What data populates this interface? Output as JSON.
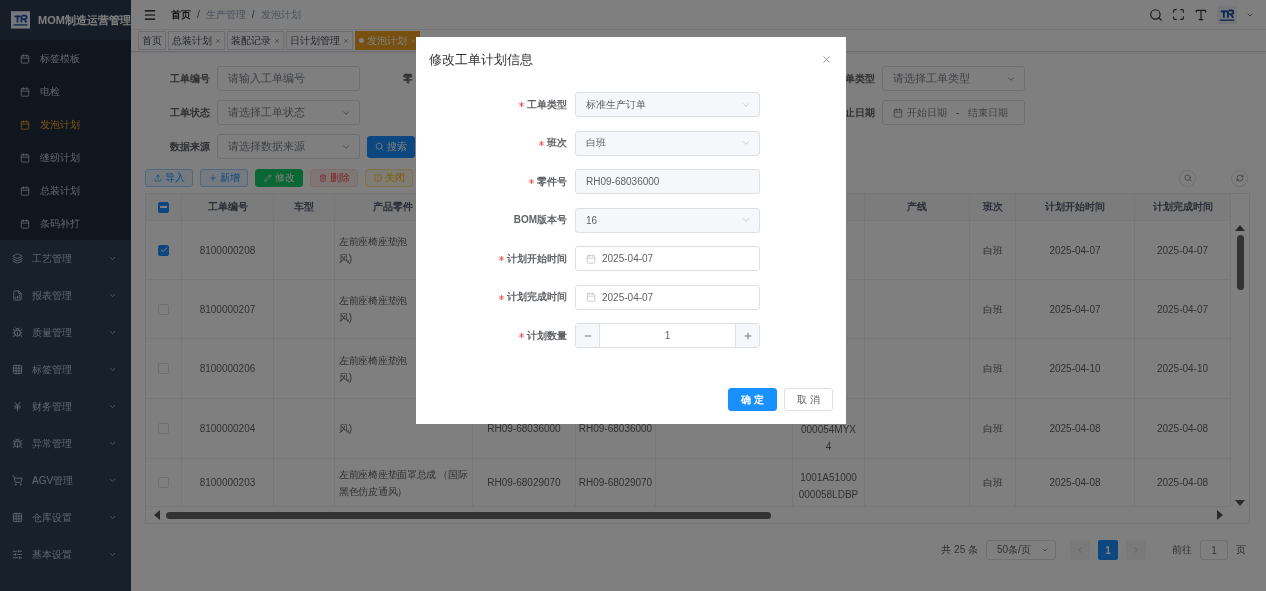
{
  "sidebar": {
    "title": "MOM制造运营管理",
    "submenu": [
      {
        "label": "标签模板",
        "selected": false
      },
      {
        "label": "电检",
        "selected": false
      },
      {
        "label": "发泡计划",
        "selected": true
      },
      {
        "label": "缝纫计划",
        "selected": false
      },
      {
        "label": "总装计划",
        "selected": false
      },
      {
        "label": "条码补打",
        "selected": false
      }
    ],
    "menus": [
      {
        "label": "工艺管理",
        "expanded": false
      },
      {
        "label": "报表管理",
        "expanded": false
      },
      {
        "label": "质量管理",
        "expanded": false
      },
      {
        "label": "标签管理",
        "expanded": false
      },
      {
        "label": "财务管理",
        "expanded": false
      },
      {
        "label": "异常管理",
        "expanded": false
      },
      {
        "label": "AGV管理",
        "expanded": false
      },
      {
        "label": "仓库设置",
        "expanded": false
      },
      {
        "label": "基本设置",
        "expanded": false
      }
    ]
  },
  "breadcrumb": [
    {
      "label": "首页"
    },
    {
      "separator": "/",
      "label": "生产管理"
    },
    {
      "separator": "/",
      "label": "发泡计划"
    }
  ],
  "tabs": [
    {
      "label": "首页",
      "closable": false,
      "selected": false
    },
    {
      "label": "总装计划",
      "closable": true,
      "selected": false
    },
    {
      "label": "装配记录",
      "closable": true,
      "selected": false
    },
    {
      "label": "日计划管理",
      "closable": true,
      "selected": false
    },
    {
      "label": "发泡计划",
      "closable": true,
      "selected": true
    }
  ],
  "filters": {
    "order_no": {
      "label": "工单编号",
      "placeholder": "请输入工单编号"
    },
    "part_label_fragment": "零",
    "order_status": {
      "label": "工单状态",
      "placeholder": "请选择工单状态"
    },
    "data_source": {
      "label": "数据来源",
      "placeholder": "请选择数据来源"
    },
    "search_button": "搜索",
    "order_type": {
      "label": "单类型",
      "placeholder": "请选择工单类型"
    },
    "date_range": {
      "label": "止日期",
      "start_placeholder": "开始日期",
      "separator": "-",
      "end_placeholder": "结束日期"
    }
  },
  "actions": [
    {
      "kind": "import",
      "label": "导入"
    },
    {
      "kind": "add",
      "label": "新增"
    },
    {
      "kind": "edit",
      "label": "修改"
    },
    {
      "kind": "delete",
      "label": "删除"
    },
    {
      "kind": "close",
      "label": "关闭"
    }
  ],
  "table": {
    "header_checkbox": {
      "indeterminate": true
    },
    "columns": {
      "order_no": "工单编号",
      "vehicle": "车型",
      "product_name": "产品零件",
      "production_line": "产线",
      "shift": "班次",
      "plan_start": "计划开始时间",
      "plan_end": "计划完成时间"
    },
    "rows": [
      {
        "selected": true,
        "order_no": "8100000208",
        "product_name": [
          "左前座椅座垫泡",
          "风)"
        ],
        "shift": "白班",
        "plan_start": "2025-04-07",
        "plan_end": "2025-04-07"
      },
      {
        "selected": false,
        "order_no": "8100000207",
        "product_name": [
          "左前座椅座垫泡",
          "风)"
        ],
        "shift": "白班",
        "plan_start": "2025-04-07",
        "plan_end": "2025-04-07"
      },
      {
        "selected": false,
        "order_no": "8100000206",
        "product_name": [
          "左前座椅座垫泡",
          "风)"
        ],
        "shift": "白班",
        "plan_start": "2025-04-10",
        "plan_end": "2025-04-10"
      },
      {
        "selected": false,
        "order_no": "8100000204",
        "product_name": [
          "风)"
        ],
        "part_no": "RH09-68036000",
        "part_no_2": "RH09-68036000",
        "column_8": [
          "000054MYX",
          "4"
        ],
        "shift": "白班",
        "plan_start": "2025-04-08",
        "plan_end": "2025-04-08"
      },
      {
        "selected": false,
        "order_no": "8100000203",
        "product_name": [
          "左前座椅座垫面罩总成 （国际",
          "黑色仿皮通风）"
        ],
        "part_no": "RH09-68029070",
        "part_no_2": "RH09-68029070",
        "column_8": [
          "1001A51000",
          "000058LDBP"
        ],
        "shift": "白班",
        "plan_start": "2025-04-08",
        "plan_end": "2025-04-08"
      }
    ]
  },
  "pagination": {
    "total": "共 25 条",
    "page_size": "50条/页",
    "pages": [
      {
        "label": "1",
        "selected": true
      }
    ],
    "jump_label": "前往",
    "jump_value": "1",
    "page_suffix": "页"
  },
  "dialog": {
    "title": "修改工单计划信息",
    "fields": [
      {
        "kind": "select",
        "label": "工单类型",
        "required": true,
        "disabled": false,
        "value": "标准生产订单"
      },
      {
        "kind": "select",
        "label": "班次",
        "required": true,
        "disabled": false,
        "value": "白班"
      },
      {
        "kind": "input",
        "label": "零件号",
        "required": true,
        "disabled": true,
        "value": "RH09-68036000"
      },
      {
        "kind": "select",
        "label": "BOM版本号",
        "required": false,
        "disabled": false,
        "value": "16"
      },
      {
        "kind": "date",
        "label": "计划开始时间",
        "required": true,
        "disabled": false,
        "value": "2025-04-07"
      },
      {
        "kind": "date",
        "label": "计划完成时间",
        "required": true,
        "disabled": false,
        "value": "2025-04-07"
      },
      {
        "kind": "number",
        "label": "计划数量",
        "required": true,
        "disabled": false,
        "value": "1"
      }
    ],
    "buttons": [
      {
        "kind": "primary",
        "label": "确 定"
      },
      {
        "kind": "default",
        "label": "取 消"
      }
    ]
  }
}
